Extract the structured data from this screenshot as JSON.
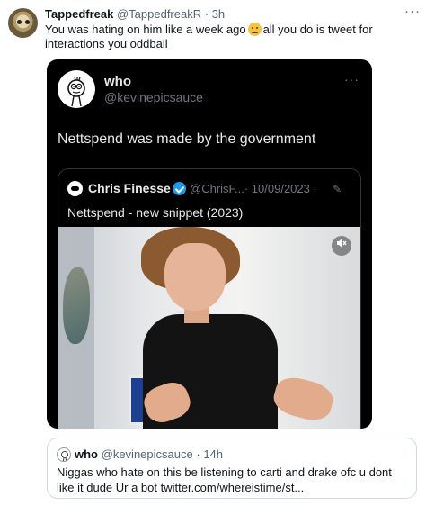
{
  "main_tweet": {
    "display_name": "Tappedfreak",
    "handle": "@TappedfreakR",
    "separator": "·",
    "time": "3h",
    "text_part1": "You was hating on him like a week ago",
    "text_emoji": "thinking-face-emoji",
    "text_part2": "all you do is tweet for interactions you oddball",
    "more": "···"
  },
  "embedded": {
    "display_name": "who",
    "handle": "@kevinepicsauce",
    "more": "···",
    "text": "Nettspend was made by the government",
    "quote": {
      "display_name": "Chris Finesse",
      "meta": "@ChrisF...· 10/09/2023 ·",
      "edit_icon": "✎",
      "text": "Nettspend - new snippet (2023)",
      "media_icon": "mute-icon"
    }
  },
  "bottom_quote": {
    "display_name": "who",
    "handle": "@kevinepicsauce",
    "separator": "·",
    "time": "14h",
    "text": "Niggas who hate on this be listening to carti and drake ofc u dont like it dude Ur a bot twitter.com/whereistime/st..."
  },
  "colors": {
    "text_primary": "#0f1419",
    "text_secondary": "#536471",
    "card_bg": "#000000",
    "verified_blue": "#1d9bf0"
  }
}
